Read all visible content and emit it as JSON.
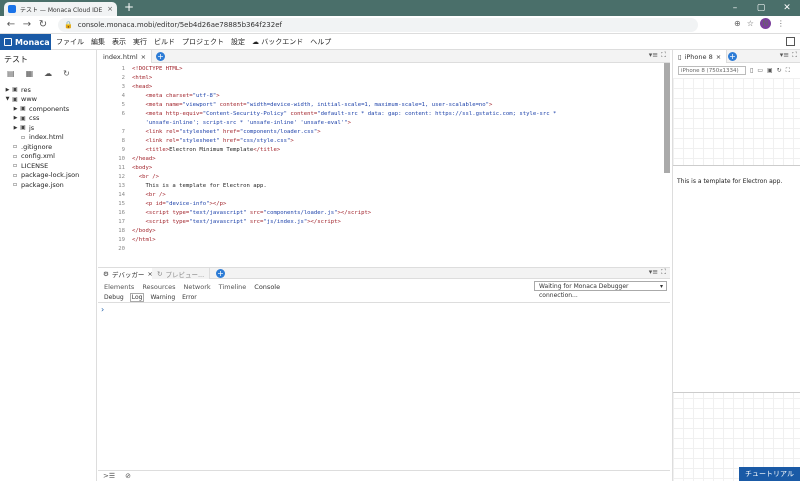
{
  "browser": {
    "tab_title": "テスト — Monaca Cloud IDE",
    "tab_close": "×",
    "new_tab": "+",
    "url": "console.monaca.mobi/editor/5eb4d26ae78885b364f232ef",
    "profile_initial": "N"
  },
  "menubar": {
    "logo": "Monaca",
    "items": [
      "ファイル",
      "編集",
      "表示",
      "実行",
      "ビルド",
      "プロジェクト",
      "設定"
    ],
    "cloud_item": "☁ バックエンド",
    "help": "ヘルプ"
  },
  "sidebar": {
    "project_name": "テスト",
    "tree": [
      {
        "label": "res",
        "toggle": "▶",
        "icon": "▣",
        "indent": 0
      },
      {
        "label": "www",
        "toggle": "▼",
        "icon": "▣",
        "indent": 0
      },
      {
        "label": "components",
        "toggle": "▶",
        "icon": "▣",
        "indent": 1
      },
      {
        "label": "css",
        "toggle": "▶",
        "icon": "▣",
        "indent": 1
      },
      {
        "label": "js",
        "toggle": "▶",
        "icon": "▣",
        "indent": 1
      },
      {
        "label": "index.html",
        "toggle": "",
        "icon": "▫",
        "indent": 1
      },
      {
        "label": ".gitignore",
        "toggle": "",
        "icon": "▫",
        "indent": 0
      },
      {
        "label": "config.xml",
        "toggle": "",
        "icon": "▫",
        "indent": 0
      },
      {
        "label": "LICENSE",
        "toggle": "",
        "icon": "▫",
        "indent": 0
      },
      {
        "label": "package-lock.json",
        "toggle": "",
        "icon": "▫",
        "indent": 0
      },
      {
        "label": "package.json",
        "toggle": "",
        "icon": "▫",
        "indent": 0
      }
    ]
  },
  "editor": {
    "tab_label": "index.html",
    "close": "×",
    "lines": [
      {
        "n": "1",
        "html": "<b>&lt;!DOCTYPE HTML&gt;</b>"
      },
      {
        "n": "2",
        "html": "<b>&lt;html&gt;</b>"
      },
      {
        "n": "3",
        "html": "<b>&lt;head&gt;</b>"
      },
      {
        "n": "4",
        "html": "    <b>&lt;meta</b> <b>charset=</b><i>\"utf-8\"</i><b>&gt;</b>"
      },
      {
        "n": "5",
        "html": "    <b>&lt;meta</b> <b>name=</b><i>\"viewport\"</i> <b>content=</b><i>\"width=device-width, initial-scale=1, maximum-scale=1, user-scalable=no\"</i><b>&gt;</b>"
      },
      {
        "n": "6",
        "html": "    <b>&lt;meta</b> <b>http-equiv=</b><i>\"Content-Security-Policy\"</i> <b>content=</b><i>\"default-src * data: gap: content: https://ssl.gstatic.com; style-src *</i>"
      },
      {
        "n": "",
        "html": "    <i>'unsafe-inline'; script-src * 'unsafe-inline' 'unsafe-eval'\"</i><b>&gt;</b>"
      },
      {
        "n": "7",
        "html": "    <b>&lt;link</b> <b>rel=</b><i>\"stylesheet\"</i> <b>href=</b><i>\"components/loader.css\"</i><b>&gt;</b>"
      },
      {
        "n": "8",
        "html": "    <b>&lt;link</b> <b>rel=</b><i>\"stylesheet\"</i> <b>href=</b><i>\"css/style.css\"</i><b>&gt;</b>"
      },
      {
        "n": "9",
        "html": "    <b>&lt;title&gt;</b>Electron Minimum Template<b>&lt;/title&gt;</b>"
      },
      {
        "n": "10",
        "html": "<b>&lt;/head&gt;</b>"
      },
      {
        "n": "11",
        "html": "<b>&lt;body&gt;</b>"
      },
      {
        "n": "12",
        "html": "  <b>&lt;br /&gt;</b>"
      },
      {
        "n": "13",
        "html": "    This is a template for Electron app."
      },
      {
        "n": "14",
        "html": "    <b>&lt;br /&gt;</b>"
      },
      {
        "n": "15",
        "html": "    <b>&lt;p</b> <b>id=</b><i>\"device-info\"</i><b>&gt;&lt;/p&gt;</b>"
      },
      {
        "n": "16",
        "html": "    <b>&lt;script</b> <b>type=</b><i>\"text/javascript\"</i> <b>src=</b><i>\"components/loader.js\"</i><b>&gt;&lt;/script&gt;</b>"
      },
      {
        "n": "17",
        "html": "    <b>&lt;script</b> <b>type=</b><i>\"text/javascript\"</i> <b>src=</b><i>\"js/index.js\"</i><b>&gt;&lt;/script&gt;</b>"
      },
      {
        "n": "18",
        "html": "<b>&lt;/body&gt;</b>"
      },
      {
        "n": "19",
        "html": "<b>&lt;/html&gt;</b>"
      },
      {
        "n": "20",
        "html": ""
      }
    ]
  },
  "debugger": {
    "tab_debugger": "デバッガー",
    "tab_preview": "プレビュー...",
    "close": "×",
    "subtabs": [
      "Elements",
      "Resources",
      "Network",
      "Timeline",
      "Console"
    ],
    "waiting": "Waiting for Monaca Debugger connection...",
    "log_tabs": [
      "Debug",
      "Log",
      "Warning",
      "Error"
    ],
    "prompt": "›"
  },
  "preview": {
    "tab_label": "iPhone 8",
    "close": "×",
    "device_select": "iPhone 8 (750x1334)",
    "content_text": "This is a template for Electron app."
  },
  "tutorial_button": "チュートリアル"
}
